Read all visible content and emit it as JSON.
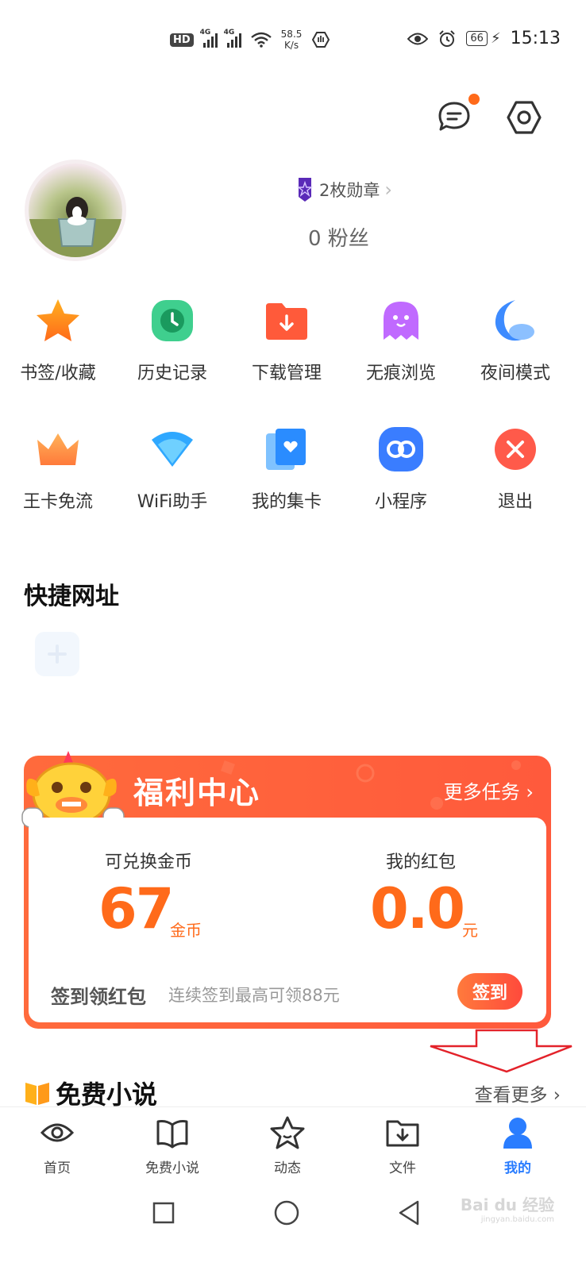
{
  "status_bar": {
    "hd": "HD",
    "net1": "4G",
    "net2": "4G",
    "speed_value": "58.5",
    "speed_unit": "K/s",
    "battery": "66",
    "time": "15:13"
  },
  "profile": {
    "badges": "2枚勋章",
    "fans": "0 粉丝"
  },
  "tools_row1": [
    {
      "label": "书签/收藏",
      "icon": "star-icon"
    },
    {
      "label": "历史记录",
      "icon": "clock-icon"
    },
    {
      "label": "下载管理",
      "icon": "download-folder-icon"
    },
    {
      "label": "无痕浏览",
      "icon": "ghost-icon"
    },
    {
      "label": "夜间模式",
      "icon": "moon-icon"
    }
  ],
  "tools_row2": [
    {
      "label": "王卡免流",
      "icon": "crown-icon"
    },
    {
      "label": "WiFi助手",
      "icon": "wifi-icon"
    },
    {
      "label": "我的集卡",
      "icon": "card-icon"
    },
    {
      "label": "小程序",
      "icon": "miniprogram-icon"
    },
    {
      "label": "退出",
      "icon": "exit-icon"
    }
  ],
  "quick_urls": {
    "title": "快捷网址"
  },
  "welfare": {
    "title": "福利中心",
    "more": "更多任务 ›",
    "coins_label": "可兑换金币",
    "coins_value": "67",
    "coins_unit": "金币",
    "redpack_label": "我的红包",
    "redpack_value": "0.0",
    "redpack_unit": "元",
    "signin_title": "签到领红包",
    "signin_desc": "连续签到最高可领88元",
    "signin_button": "签到"
  },
  "novels": {
    "title": "免费小说",
    "see_more": "查看更多 ›"
  },
  "bottom_nav": [
    {
      "label": "首页",
      "icon": "eye-icon"
    },
    {
      "label": "免费小说",
      "icon": "book-open-icon"
    },
    {
      "label": "动态",
      "icon": "star-face-icon"
    },
    {
      "label": "文件",
      "icon": "file-download-icon"
    },
    {
      "label": "我的",
      "icon": "user-icon",
      "active": true
    }
  ],
  "watermark": {
    "brand": "Bai du 经验",
    "url": "jingyan.baidu.com"
  },
  "colors": {
    "accent_orange": "#ff6a1a",
    "welfare_red": "#ff5a3c",
    "nav_active_blue": "#2a7dff"
  }
}
